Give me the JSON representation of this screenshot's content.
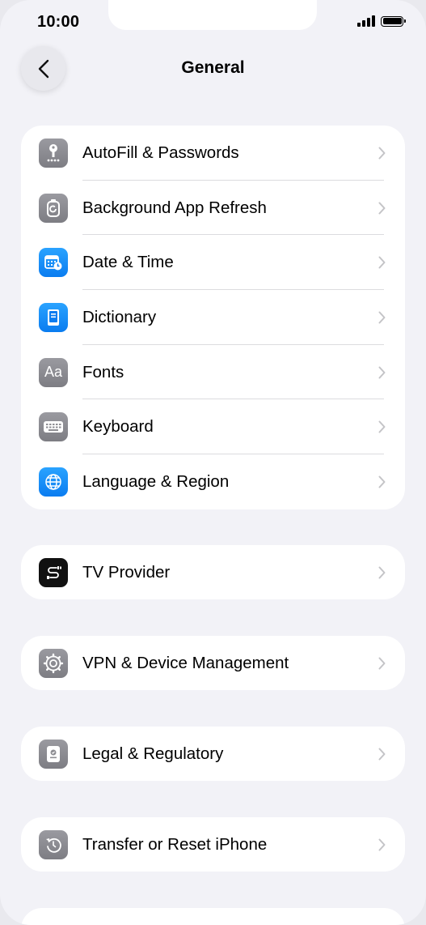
{
  "status": {
    "time": "10:00"
  },
  "nav": {
    "title": "General"
  },
  "groups": [
    {
      "items": [
        {
          "label": "AutoFill & Passwords",
          "icon": "key-icon",
          "color": "#8e8e93"
        },
        {
          "label": "Background App Refresh",
          "icon": "refresh-icon",
          "color": "#8e8e93"
        },
        {
          "label": "Date & Time",
          "icon": "calendar-clock-icon",
          "color": "#0a84ff"
        },
        {
          "label": "Dictionary",
          "icon": "book-icon",
          "color": "#0a84ff"
        },
        {
          "label": "Fonts",
          "icon": "fonts-icon",
          "icon_text": "Aa",
          "color": "#8e8e93"
        },
        {
          "label": "Keyboard",
          "icon": "keyboard-icon",
          "color": "#8e8e93"
        },
        {
          "label": "Language & Region",
          "icon": "globe-icon",
          "color": "#0a84ff"
        }
      ]
    },
    {
      "items": [
        {
          "label": "TV Provider",
          "icon": "tv-provider-icon",
          "color": "#111111"
        }
      ]
    },
    {
      "items": [
        {
          "label": "VPN & Device Management",
          "icon": "gear-icon",
          "color": "#8e8e93"
        }
      ]
    },
    {
      "items": [
        {
          "label": "Legal & Regulatory",
          "icon": "document-badge-icon",
          "color": "#8e8e93"
        }
      ]
    },
    {
      "items": [
        {
          "label": "Transfer or Reset iPhone",
          "icon": "reset-icon",
          "color": "#8e8e93"
        }
      ]
    }
  ]
}
